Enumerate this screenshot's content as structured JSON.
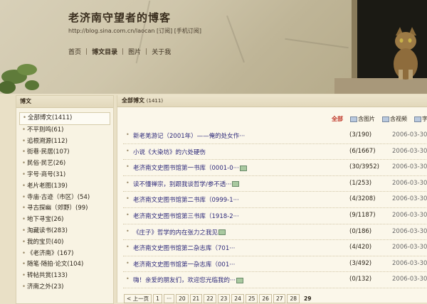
{
  "header": {
    "title": "老济南守望者的博客",
    "url": "http://blog.sina.com.cn/laocan",
    "subscribe": "[订阅]",
    "mobile_subscribe": "[手机订阅]",
    "nav": [
      {
        "label": "首页",
        "active": false
      },
      {
        "label": "博文目录",
        "active": true
      },
      {
        "label": "图片",
        "active": false
      },
      {
        "label": "关于我",
        "active": false
      }
    ],
    "nav_sep": "|"
  },
  "sidebar": {
    "title": "博文",
    "categories": [
      {
        "label": "全部博文",
        "count": "(1411)",
        "selected": true
      },
      {
        "label": "不平则鸣",
        "count": "(61)"
      },
      {
        "label": "追根溯源",
        "count": "(112)"
      },
      {
        "label": "街巷·民居",
        "count": "(107)"
      },
      {
        "label": "民俗·民艺",
        "count": "(26)"
      },
      {
        "label": "字号·商号",
        "count": "(31)"
      },
      {
        "label": "老片老图",
        "count": "(139)"
      },
      {
        "label": "寺庙·古迹（市区）",
        "count": "(54)"
      },
      {
        "label": "寻古探幽（郊野）",
        "count": "(99)"
      },
      {
        "label": "地下寻宝",
        "count": "(26)"
      },
      {
        "label": "淘藏读书",
        "count": "(283)"
      },
      {
        "label": "我的宝贝",
        "count": "(40)"
      },
      {
        "label": "《老济南》",
        "count": "(167)"
      },
      {
        "label": "随笔·随拍·论文",
        "count": "(104)"
      },
      {
        "label": "转帖共赏",
        "count": "(133)"
      },
      {
        "label": "济南之外",
        "count": "(23)"
      }
    ]
  },
  "main": {
    "title": "全部博文",
    "count": "(1411)",
    "filters": [
      {
        "label": "全部",
        "active": true,
        "icon": ""
      },
      {
        "label": "含图片",
        "active": false,
        "icon": "image-icon"
      },
      {
        "label": "含视频",
        "active": false,
        "icon": "video-icon"
      },
      {
        "label": "字",
        "active": false,
        "icon": "image-icon"
      }
    ],
    "posts": [
      {
        "title": "新老羌游记（2001年）——俺的处女作···",
        "img": false,
        "stats": "(3/190)",
        "date": "2006-03-30"
      },
      {
        "title": "小说《大染坊》的六处硬伤",
        "img": false,
        "stats": "(6/1667)",
        "date": "2006-03-30"
      },
      {
        "title": "老济南文史图书馆第一书库（0001-0···",
        "img": true,
        "stats": "(30/3952)",
        "date": "2006-03-30"
      },
      {
        "title": "读不懂禅宗，别跟我谈哲学/参不透···",
        "img": true,
        "stats": "(1/253)",
        "date": "2006-03-30"
      },
      {
        "title": "老济南文史图书馆第二书库（0999-1···",
        "img": false,
        "stats": "(4/3208)",
        "date": "2006-03-30"
      },
      {
        "title": "老济南文史图书馆第三书库（1918-2···",
        "img": false,
        "stats": "(9/1187)",
        "date": "2006-03-30"
      },
      {
        "title": "《庄子》哲学的内在张力之我见",
        "img": true,
        "stats": "(0/186)",
        "date": "2006-03-30"
      },
      {
        "title": "老济南文史图书馆第二杂志库（701···",
        "img": false,
        "stats": "(4/420)",
        "date": "2006-03-30"
      },
      {
        "title": "老济南文史图书馆第一杂志库（001···",
        "img": false,
        "stats": "(3/492)",
        "date": "2006-03-30"
      },
      {
        "title": "嗨！亲爱的朋友们，欢迎您光临我的···",
        "img": true,
        "stats": "(0/132)",
        "date": "2006-03-30"
      }
    ]
  },
  "pager": {
    "prev": "< 上一页",
    "pages": [
      "1",
      "···",
      "20",
      "21",
      "22",
      "23",
      "24",
      "25",
      "26",
      "27",
      "28",
      "29"
    ],
    "current": "29"
  }
}
